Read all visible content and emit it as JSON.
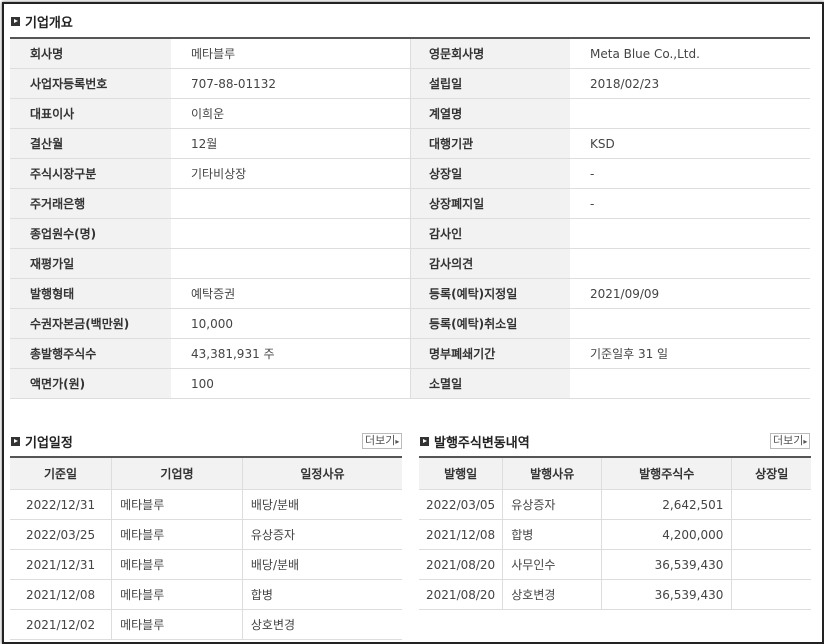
{
  "overview": {
    "title": "기업개요",
    "rows": [
      {
        "label1": "회사명",
        "value1": "메타블루",
        "label2": "영문회사명",
        "value2": "Meta Blue Co.,Ltd."
      },
      {
        "label1": "사업자등록번호",
        "value1": "707-88-01132",
        "label2": "설립일",
        "value2": "2018/02/23"
      },
      {
        "label1": "대표이사",
        "value1": "이희운",
        "label2": "계열명",
        "value2": ""
      },
      {
        "label1": "결산월",
        "value1": "12월",
        "label2": "대행기관",
        "value2": "KSD"
      },
      {
        "label1": "주식시장구분",
        "value1": "기타비상장",
        "label2": "상장일",
        "value2": "-"
      },
      {
        "label1": "주거래은행",
        "value1": "",
        "label2": "상장폐지일",
        "value2": "-"
      },
      {
        "label1": "종업원수(명)",
        "value1": "",
        "label2": "감사인",
        "value2": ""
      },
      {
        "label1": "재평가일",
        "value1": "",
        "label2": "감사의견",
        "value2": ""
      },
      {
        "label1": "발행형태",
        "value1": "예탁증권",
        "label2": "등록(예탁)지정일",
        "value2": "2021/09/09"
      },
      {
        "label1": "수권자본금(백만원)",
        "value1": "10,000",
        "label2": "등록(예탁)취소일",
        "value2": ""
      },
      {
        "label1": "총발행주식수",
        "value1": "43,381,931 주",
        "label2": "명부폐쇄기간",
        "value2": "기준일후 31 일"
      },
      {
        "label1": "액면가(원)",
        "value1": "100",
        "label2": "소멸일",
        "value2": ""
      }
    ]
  },
  "schedule": {
    "title": "기업일정",
    "more_label": "더보기",
    "headers": [
      "기준일",
      "기업명",
      "일정사유"
    ],
    "rows": [
      [
        "2022/12/31",
        "메타블루",
        "배당/분배"
      ],
      [
        "2022/03/25",
        "메타블루",
        "유상증자"
      ],
      [
        "2021/12/31",
        "메타블루",
        "배당/분배"
      ],
      [
        "2021/12/08",
        "메타블루",
        "합병"
      ],
      [
        "2021/12/02",
        "메타블루",
        "상호변경"
      ]
    ]
  },
  "issuance": {
    "title": "발행주식변동내역",
    "more_label": "더보기",
    "headers": [
      "발행일",
      "발행사유",
      "발행주식수",
      "상장일"
    ],
    "rows": [
      [
        "2022/03/05",
        "유상증자",
        "2,642,501",
        ""
      ],
      [
        "2021/12/08",
        "합병",
        "4,200,000",
        ""
      ],
      [
        "2021/08/20",
        "사무인수",
        "36,539,430",
        ""
      ],
      [
        "2021/08/20",
        "상호변경",
        "36,539,430",
        ""
      ]
    ]
  }
}
